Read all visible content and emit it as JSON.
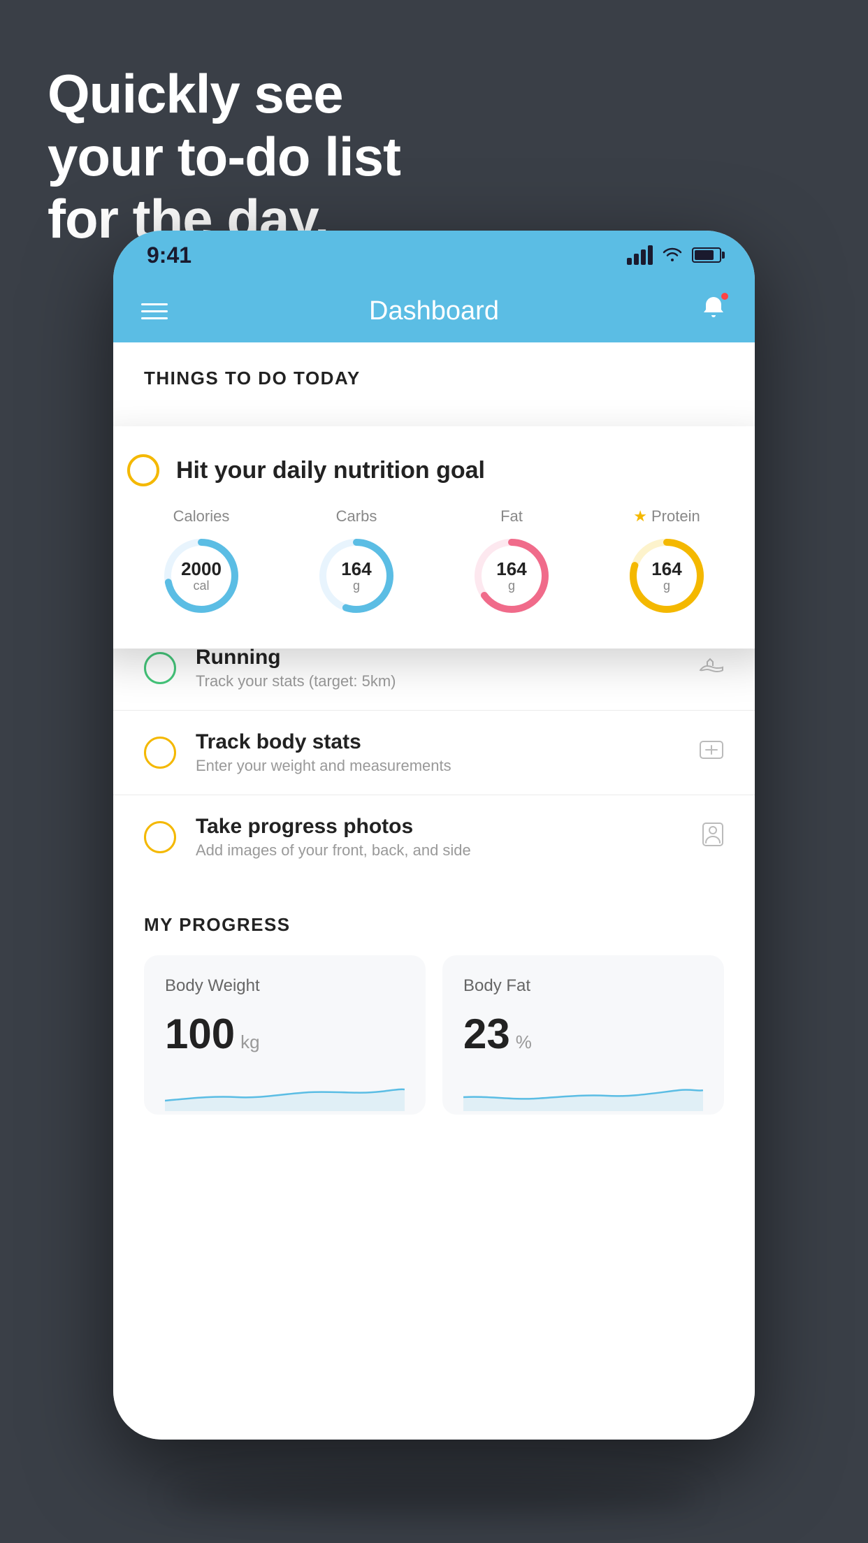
{
  "background_color": "#3a3f47",
  "headline": {
    "line1": "Quickly see",
    "line2": "your to-do list",
    "line3": "for the day."
  },
  "status_bar": {
    "time": "9:41"
  },
  "app_header": {
    "title": "Dashboard"
  },
  "things_section": {
    "label": "THINGS TO DO TODAY"
  },
  "nutrition_card": {
    "title": "Hit your daily nutrition goal",
    "macros": [
      {
        "label": "Calories",
        "value": "2000",
        "unit": "cal",
        "color": "#5bbde4",
        "progress": 0.72,
        "starred": false
      },
      {
        "label": "Carbs",
        "value": "164",
        "unit": "g",
        "color": "#5bbde4",
        "progress": 0.55,
        "starred": false
      },
      {
        "label": "Fat",
        "value": "164",
        "unit": "g",
        "color": "#f06b8a",
        "progress": 0.65,
        "starred": false
      },
      {
        "label": "Protein",
        "value": "164",
        "unit": "g",
        "color": "#f4b800",
        "progress": 0.8,
        "starred": true
      }
    ]
  },
  "todo_items": [
    {
      "title": "Running",
      "subtitle": "Track your stats (target: 5km)",
      "circle_color": "green",
      "icon": "shoe"
    },
    {
      "title": "Track body stats",
      "subtitle": "Enter your weight and measurements",
      "circle_color": "yellow",
      "icon": "scale"
    },
    {
      "title": "Take progress photos",
      "subtitle": "Add images of your front, back, and side",
      "circle_color": "yellow",
      "icon": "person"
    }
  ],
  "progress_section": {
    "label": "MY PROGRESS",
    "cards": [
      {
        "title": "Body Weight",
        "value": "100",
        "unit": "kg"
      },
      {
        "title": "Body Fat",
        "value": "23",
        "unit": "%"
      }
    ]
  }
}
